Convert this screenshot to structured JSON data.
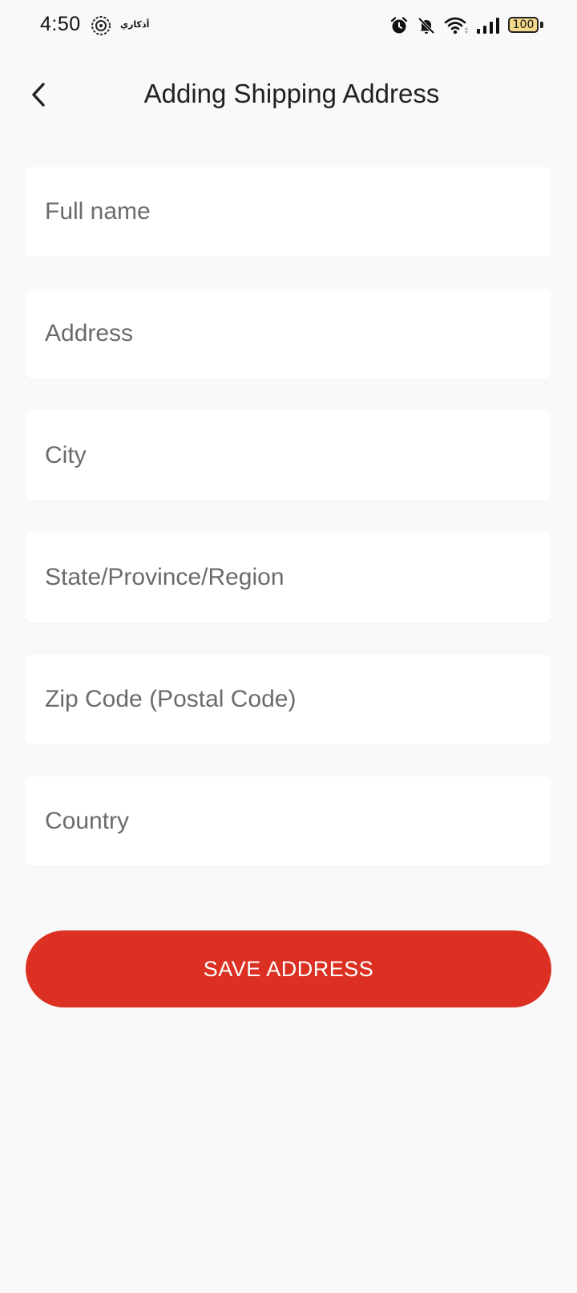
{
  "status_bar": {
    "time": "4:50",
    "app_label": "أذكاري",
    "battery_level": "100",
    "icons": [
      "alarm-icon",
      "bell-muted-icon",
      "wifi-icon",
      "signal-icon",
      "battery-icon"
    ]
  },
  "header": {
    "title": "Adding Shipping Address",
    "back_icon": "chevron-left-icon"
  },
  "form": {
    "fields": [
      {
        "placeholder": "Full name",
        "value": ""
      },
      {
        "placeholder": "Address",
        "value": ""
      },
      {
        "placeholder": "City",
        "value": ""
      },
      {
        "placeholder": "State/Province/Region",
        "value": ""
      },
      {
        "placeholder": "Zip Code (Postal Code)",
        "value": ""
      },
      {
        "placeholder": "Country",
        "value": ""
      }
    ],
    "save_label": "SAVE ADDRESS"
  },
  "colors": {
    "accent": "#db3022",
    "background": "#f9f9f9",
    "field_background": "#ffffff",
    "placeholder": "#6b6b6b"
  }
}
